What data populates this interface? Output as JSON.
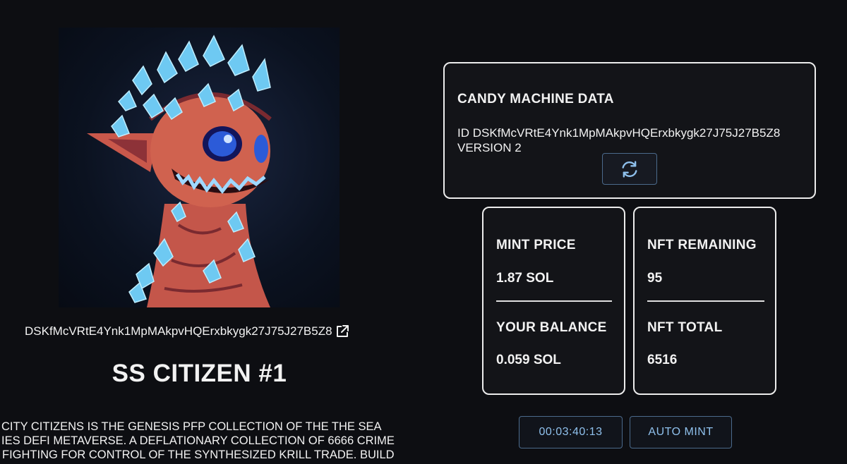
{
  "nft": {
    "mint_address": "DSKfMcVRtE4Ynk1MpMAkpvHQErxbkygk27J75J27B5Z8",
    "title": "SS CITIZEN #1",
    "description_lines": [
      "CITY CITIZENS IS THE GENESIS PFP COLLECTION OF THE THE SEA",
      "IES DEFI METAVERSE. A DEFLATIONARY COLLECTION OF 6666 CRIME",
      "FIGHTING FOR CONTROL OF THE SYNTHESIZED KRILL TRADE. BUILD"
    ],
    "image_icon": "crystal-creature-image"
  },
  "candy_machine": {
    "heading": "CANDY MACHINE DATA",
    "id_line": "ID DSKfMcVRtE4Ynk1MpMAkpvHQErxbkygk27J75J27B5Z8",
    "version_line": "VERSION 2",
    "refresh_icon": "refresh-icon"
  },
  "stats": {
    "mint_price_label": "MINT PRICE",
    "mint_price_value": "1.87 SOL",
    "your_balance_label": "YOUR BALANCE",
    "your_balance_value": "0.059 SOL",
    "nft_remaining_label": "NFT REMAINING",
    "nft_remaining_value": "95",
    "nft_total_label": "NFT TOTAL",
    "nft_total_value": "6516"
  },
  "controls": {
    "timer": "00:03:40:13",
    "auto_mint_label": "AUTO MINT"
  },
  "colors": {
    "background": "#0d0e12",
    "card_border": "#ececec",
    "button_border": "#4b6a8c",
    "button_text": "#8fc0ec"
  }
}
